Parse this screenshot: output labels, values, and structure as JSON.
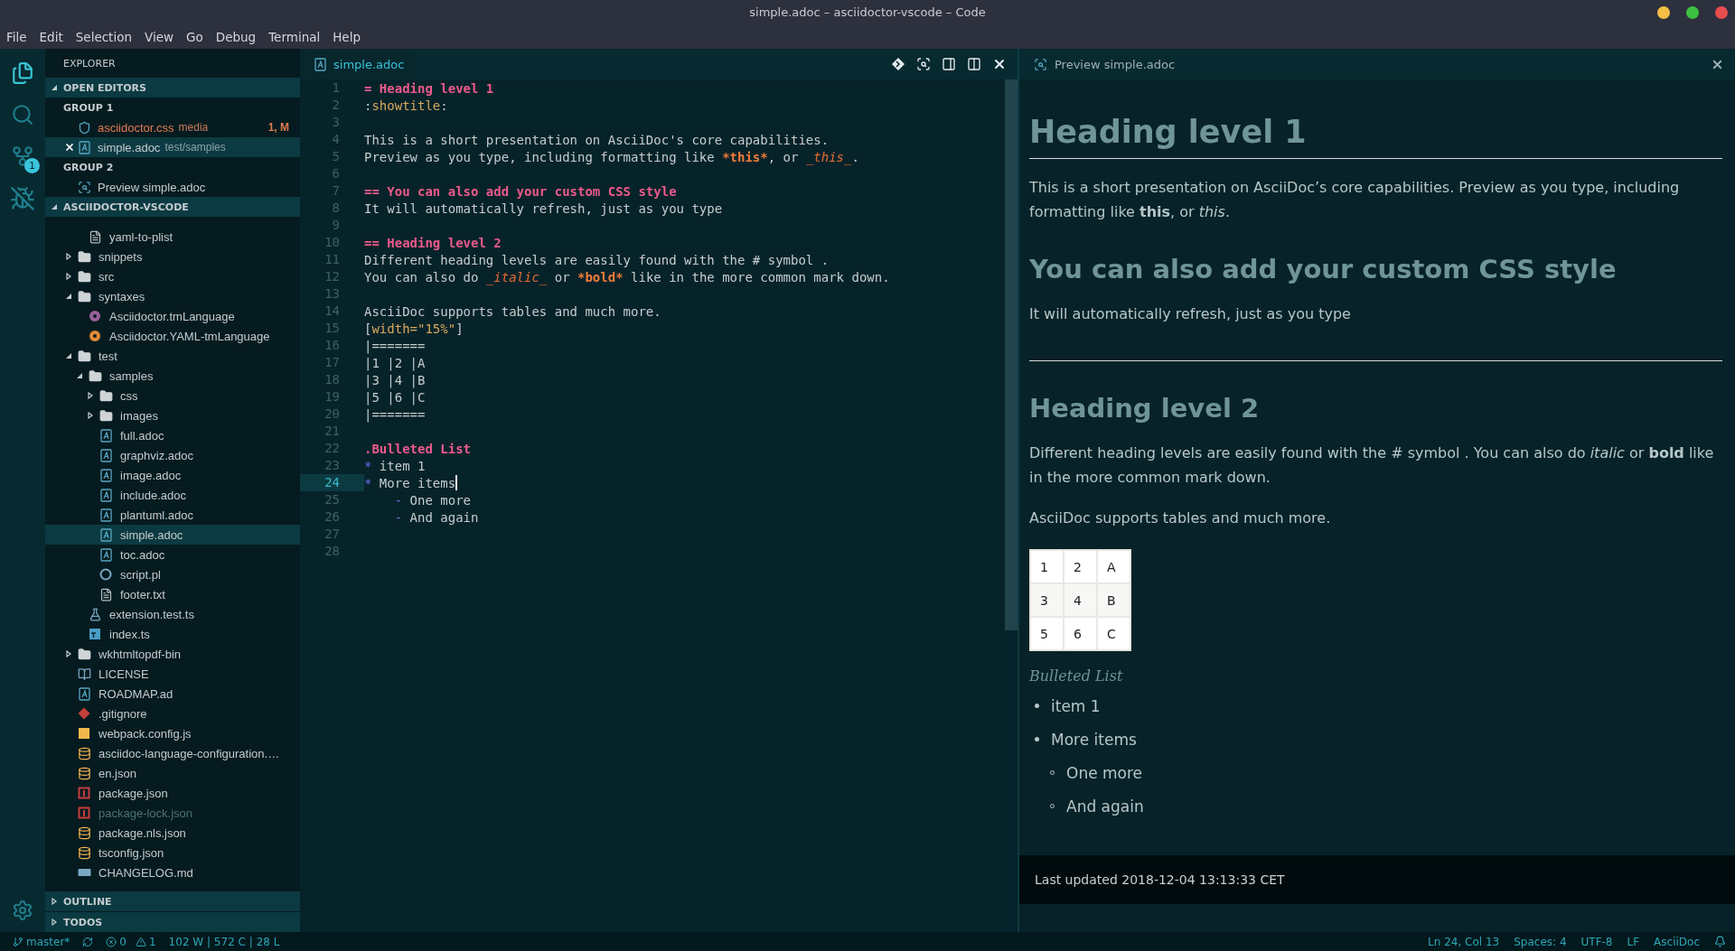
{
  "window": {
    "title": "simple.adoc – asciidoctor-vscode – Code"
  },
  "menu": [
    "File",
    "Edit",
    "Selection",
    "View",
    "Go",
    "Debug",
    "Terminal",
    "Help"
  ],
  "activity_bar": [
    {
      "kind": "explorer",
      "selected": true
    },
    {
      "kind": "search",
      "selected": false
    },
    {
      "kind": "source-control",
      "selected": false,
      "badge": "1"
    },
    {
      "kind": "debug",
      "selected": false
    }
  ],
  "sidebar": {
    "title": "EXPLORER",
    "open_editors": {
      "title": "OPEN EDITORS",
      "expanded": true,
      "groups": [
        {
          "title": "GROUP 1",
          "editors": [
            {
              "label": "asciidoctor.css",
              "description": "media",
              "kind": "css",
              "modified": true,
              "selected": false,
              "badge": "1, M"
            },
            {
              "label": "simple.adoc",
              "description": "test/samples",
              "kind": "adoc",
              "modified": false,
              "selected": true
            }
          ]
        },
        {
          "title": "GROUP 2",
          "editors": [
            {
              "label": "Preview simple.adoc",
              "kind": "preview",
              "modified": false,
              "selected": false
            }
          ]
        }
      ]
    },
    "folder": {
      "title": "ASCIIDOCTOR-VSCODE",
      "expanded": true,
      "tree": [
        {
          "children": [
            {
              "label": "yaml-to-plist",
              "kind": "file",
              "selected": false,
              "ignored": false
            }
          ]
        },
        {
          "label": "snippets",
          "kind": "folder",
          "expanded": false,
          "selected": false,
          "ignored": false
        },
        {
          "label": "src",
          "kind": "folder",
          "expanded": false,
          "selected": false,
          "ignored": false
        },
        {
          "label": "syntaxes",
          "kind": "folder",
          "expanded": true,
          "selected": false,
          "ignored": false,
          "children": [
            {
              "label": "Asciidoctor.tmLanguage",
              "kind": "tmlang",
              "selected": false,
              "ignored": false
            },
            {
              "label": "Asciidoctor.YAML-tmLanguage",
              "kind": "yaml-tmlang",
              "selected": false,
              "ignored": false
            }
          ]
        },
        {
          "label": "test",
          "kind": "folder",
          "expanded": true,
          "selected": false,
          "ignored": false,
          "children": [
            {
              "label": "samples",
              "kind": "folder",
              "expanded": true,
              "selected": false,
              "ignored": false,
              "children": [
                {
                  "label": "css",
                  "kind": "folder",
                  "expanded": false,
                  "selected": false,
                  "ignored": false
                },
                {
                  "label": "images",
                  "kind": "folder",
                  "expanded": false,
                  "selected": false,
                  "ignored": false
                },
                {
                  "label": "full.adoc",
                  "kind": "adoc",
                  "selected": false,
                  "ignored": false
                },
                {
                  "label": "graphviz.adoc",
                  "kind": "adoc",
                  "selected": false,
                  "ignored": false
                },
                {
                  "label": "image.adoc",
                  "kind": "adoc",
                  "selected": false,
                  "ignored": false
                },
                {
                  "label": "include.adoc",
                  "kind": "adoc",
                  "selected": false,
                  "ignored": false
                },
                {
                  "label": "plantuml.adoc",
                  "kind": "adoc",
                  "selected": false,
                  "ignored": false
                },
                {
                  "label": "simple.adoc",
                  "kind": "adoc",
                  "selected": true,
                  "ignored": false
                },
                {
                  "label": "toc.adoc",
                  "kind": "adoc",
                  "selected": false,
                  "ignored": false
                },
                {
                  "label": "script.pl",
                  "kind": "perl",
                  "selected": false,
                  "ignored": false
                },
                {
                  "label": "footer.txt",
                  "kind": "file",
                  "selected": false,
                  "ignored": false
                }
              ]
            },
            {
              "label": "extension.test.ts",
              "kind": "test-ts",
              "selected": false,
              "ignored": false
            },
            {
              "label": "index.ts",
              "kind": "ts",
              "selected": false,
              "ignored": false
            }
          ]
        },
        {
          "label": "wkhtmltopdf-bin",
          "kind": "folder",
          "expanded": false,
          "selected": false,
          "ignored": false
        },
        {
          "label": "LICENSE",
          "kind": "license",
          "selected": false,
          "ignored": false
        },
        {
          "label": "ROADMAP.ad",
          "kind": "adoc",
          "selected": false,
          "ignored": false
        },
        {
          "label": ".gitignore",
          "kind": "git",
          "selected": false,
          "ignored": false
        },
        {
          "label": "webpack.config.js",
          "kind": "js",
          "selected": false,
          "ignored": false
        },
        {
          "label": "asciidoc-language-configuration.…",
          "kind": "db",
          "selected": false,
          "ignored": false
        },
        {
          "label": "en.json",
          "kind": "db",
          "selected": false,
          "ignored": false
        },
        {
          "label": "package.json",
          "kind": "npm",
          "selected": false,
          "ignored": false
        },
        {
          "label": "package-lock.json",
          "kind": "npm",
          "selected": false,
          "ignored": true
        },
        {
          "label": "package.nls.json",
          "kind": "db",
          "selected": false,
          "ignored": false
        },
        {
          "label": "tsconfig.json",
          "kind": "db",
          "selected": false,
          "ignored": false
        },
        {
          "label": "CHANGELOG.md",
          "kind": "md",
          "selected": false,
          "ignored": false
        }
      ]
    },
    "panels": [
      {
        "title": "OUTLINE",
        "expanded": false
      },
      {
        "title": "TODOS",
        "expanded": false
      }
    ]
  },
  "editor": {
    "tab": {
      "label": "simple.adoc"
    },
    "lines": [
      {
        "number": "1",
        "current": false,
        "segments": [
          {
            "text": "= Heading level 1",
            "kind": "heading"
          }
        ]
      },
      {
        "number": "2",
        "current": false,
        "segments": [
          {
            "text": ":",
            "kind": "plain"
          },
          {
            "text": "showtitle",
            "kind": "attr"
          },
          {
            "text": ":",
            "kind": "plain"
          }
        ]
      },
      {
        "number": "3",
        "current": false
      },
      {
        "number": "4",
        "current": false,
        "segments": [
          {
            "text": "This is a short presentation on AsciiDoc's core capabilities.",
            "kind": "plain"
          }
        ]
      },
      {
        "number": "5",
        "current": false,
        "segments": [
          {
            "text": "Preview as you type, including formatting like ",
            "kind": "plain"
          },
          {
            "text": "*this*",
            "kind": "strong"
          },
          {
            "text": ", or ",
            "kind": "plain"
          },
          {
            "text": "_this_",
            "kind": "emphasis"
          },
          {
            "text": ".",
            "kind": "plain"
          }
        ]
      },
      {
        "number": "6",
        "current": false
      },
      {
        "number": "7",
        "current": false,
        "segments": [
          {
            "text": "== You can also add your custom CSS style",
            "kind": "heading"
          }
        ]
      },
      {
        "number": "8",
        "current": false,
        "segments": [
          {
            "text": "It will automatically refresh, just as you type",
            "kind": "plain"
          }
        ]
      },
      {
        "number": "9",
        "current": false
      },
      {
        "number": "10",
        "current": false,
        "segments": [
          {
            "text": "== Heading level 2",
            "kind": "heading"
          }
        ]
      },
      {
        "number": "11",
        "current": false,
        "segments": [
          {
            "text": "Different heading levels are easily found with the # symbol .",
            "kind": "plain"
          }
        ]
      },
      {
        "number": "12",
        "current": false,
        "segments": [
          {
            "text": "You can also do ",
            "kind": "plain"
          },
          {
            "text": "_italic_",
            "kind": "emphasis"
          },
          {
            "text": " or ",
            "kind": "plain"
          },
          {
            "text": "*bold*",
            "kind": "strong"
          },
          {
            "text": " like in the more common mark down.",
            "kind": "plain"
          }
        ]
      },
      {
        "number": "13",
        "current": false
      },
      {
        "number": "14",
        "current": false,
        "segments": [
          {
            "text": "AsciiDoc supports tables and much more.",
            "kind": "plain"
          }
        ]
      },
      {
        "number": "15",
        "current": false,
        "segments": [
          {
            "text": "[",
            "kind": "plain"
          },
          {
            "text": "width=\"15%\"",
            "kind": "attr"
          },
          {
            "text": "]",
            "kind": "plain"
          }
        ]
      },
      {
        "number": "16",
        "current": false,
        "segments": [
          {
            "text": "|=======",
            "kind": "plain"
          }
        ]
      },
      {
        "number": "17",
        "current": false,
        "segments": [
          {
            "text": "|1 |2 |A",
            "kind": "plain"
          }
        ]
      },
      {
        "number": "18",
        "current": false,
        "segments": [
          {
            "text": "|3 |4 |B",
            "kind": "plain"
          }
        ]
      },
      {
        "number": "19",
        "current": false,
        "segments": [
          {
            "text": "|5 |6 |C",
            "kind": "plain"
          }
        ]
      },
      {
        "number": "20",
        "current": false,
        "segments": [
          {
            "text": "|=======",
            "kind": "plain"
          }
        ]
      },
      {
        "number": "21",
        "current": false
      },
      {
        "number": "22",
        "current": false,
        "segments": [
          {
            "text": ".Bulleted List",
            "kind": "heading"
          }
        ]
      },
      {
        "number": "23",
        "current": false,
        "segments": [
          {
            "text": "*",
            "kind": "bullet"
          },
          {
            "text": " item 1",
            "kind": "plain"
          }
        ]
      },
      {
        "number": "24",
        "current": true,
        "segments": [
          {
            "text": "*",
            "kind": "bullet"
          },
          {
            "text": " More items",
            "kind": "plain"
          }
        ]
      },
      {
        "number": "25",
        "current": false,
        "segments": [
          {
            "text": "-",
            "kind": "dash"
          },
          {
            "text": " One more",
            "kind": "plain"
          }
        ]
      },
      {
        "number": "26",
        "current": false,
        "segments": [
          {
            "text": "-",
            "kind": "dash"
          },
          {
            "text": " And again",
            "kind": "plain"
          }
        ]
      },
      {
        "number": "27",
        "current": false
      },
      {
        "number": "28",
        "current": false
      }
    ]
  },
  "preview": {
    "tab": {
      "label": "Preview simple.adoc"
    },
    "blocks": [
      {
        "kind": "h1",
        "text": "Heading level 1"
      },
      {
        "kind": "paragraph",
        "text": "This is a short presentation on AsciiDoc’s core capabilities. Preview as you type, including formatting like **this**, or *this*."
      },
      {
        "kind": "h2",
        "text": "You can also add your custom CSS style"
      },
      {
        "kind": "paragraph",
        "text": "It will automatically refresh, just as you type"
      },
      {
        "kind": "rule"
      },
      {
        "kind": "h2",
        "text": "Heading level 2"
      },
      {
        "kind": "paragraph",
        "text": "Different heading levels are easily found with the # symbol . You can also do *italic* or **bold** like in the more common mark down."
      },
      {
        "kind": "paragraph",
        "text": "AsciiDoc supports tables and much more."
      },
      {
        "kind": "table",
        "rows": [
          [
            "1",
            "2",
            "A"
          ],
          [
            "3",
            "4",
            "B"
          ],
          [
            "5",
            "6",
            "C"
          ]
        ]
      },
      {
        "kind": "caption",
        "text": "Bulleted List"
      },
      {
        "kind": "list",
        "items": [
          {
            "text": "item 1"
          },
          {
            "text": "More items",
            "children": [
              {
                "text": "One more"
              },
              {
                "text": "And again"
              }
            ]
          }
        ]
      }
    ],
    "footer": "Last updated 2018-12-04 13:13:33 CET"
  },
  "status_bar": {
    "branch": "master*",
    "errors": "0",
    "warnings": "1",
    "stats": "102 W | 572 C | 28 L",
    "right": [
      "Ln 24, Col 13",
      "Spaces: 4",
      "UTF-8",
      "LF",
      "AsciiDoc"
    ]
  }
}
